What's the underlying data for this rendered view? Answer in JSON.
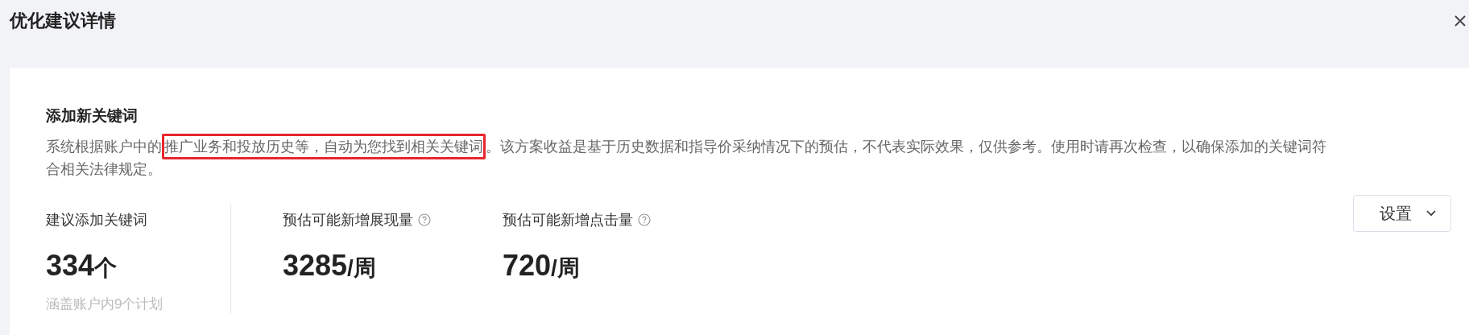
{
  "window": {
    "title": "优化建议详情"
  },
  "section": {
    "title": "添加新关键词",
    "description": {
      "before": "系统根据账户中的",
      "highlighted": "推广业务和投放历史等，自动为您找到相关关键词",
      "after": "。该方案收益是基于历史数据和指导价采纳情况下的预估，不代表实际效果，仅供参考。使用时请再次检查，以确保添加的关键词符合相关法律规定。"
    }
  },
  "stats": [
    {
      "label": "建议添加关键词",
      "value": "334",
      "unit": "个",
      "note": "涵盖账户内9个计划",
      "help": false
    },
    {
      "label": "预估可能新增展现量",
      "value": "3285",
      "unit": "/周",
      "help": true
    },
    {
      "label": "预估可能新增点击量",
      "value": "720",
      "unit": "/周",
      "help": true
    }
  ],
  "settings_button": {
    "label": "设置"
  }
}
